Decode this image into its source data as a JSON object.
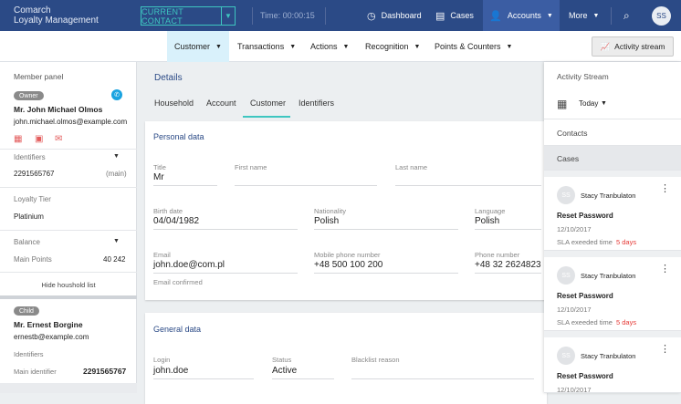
{
  "app": {
    "brand_line1": "Comarch",
    "brand_line2": "Loyalty Management"
  },
  "topbar": {
    "current_contact": "CURRENT CONTACT",
    "timer": "Time: 00:00:15",
    "dashboard": "Dashboard",
    "cases": "Cases",
    "accounts": "Accounts",
    "more": "More",
    "user_initials": "SS"
  },
  "menu": {
    "customer": "Customer",
    "transactions": "Transactions",
    "actions": "Actions",
    "recognition": "Recognition",
    "points_counters": "Points & Counters",
    "activity_stream_btn": "Activity stream"
  },
  "member_panel": {
    "title": "Member panel",
    "owner_badge": "Owner",
    "owner_name": "Mr. John Michael Olmos",
    "owner_email": "john.michael.olmos@example.com",
    "identifiers_label": "Identifiers",
    "identifier_value": "2291565767",
    "identifier_tag": "(main)",
    "tier_label": "Loyalty Tier",
    "tier_value": "Platinium",
    "balance_label": "Balance",
    "main_points_label": "Main Points",
    "main_points_value": "40 242",
    "hide_household": "Hide houshold list",
    "child_badge": "Child",
    "child_name": "Mr. Ernest Borgine",
    "child_email": "ernestb@example.com",
    "child_identifiers_label": "Identifiers",
    "child_main_identifier_label": "Main identifier",
    "child_main_identifier_value": "2291565767"
  },
  "details": {
    "title": "Details",
    "tabs": [
      "Household",
      "Account",
      "Customer",
      "Identifiers"
    ],
    "personal_title": "Personal data",
    "title_label": "Title",
    "title_value": "Mr",
    "first_name_label": "First name",
    "last_name_label": "Last name",
    "birth_label": "Birth date",
    "birth_value": "04/04/1982",
    "nationality_label": "Nationality",
    "nationality_value": "Polish",
    "language_label": "Language",
    "language_value": "Polish",
    "email_label": "Email",
    "email_value": "john.doe@com.pl",
    "mobile_label": "Mobile phone number",
    "mobile_value": "+48 500 100 200",
    "phone_label": "Phone number",
    "phone_value": "+48 32 2624823",
    "email_confirmed": "Email confirmed",
    "general_title": "General data",
    "login_label": "Login",
    "login_value": "john.doe",
    "status_label": "Status",
    "status_value": "Active",
    "blacklist_label": "Blacklist reason"
  },
  "activity": {
    "title": "Activity Stream",
    "period": "Today",
    "contacts": "Contacts",
    "cases": "Cases",
    "items": [
      {
        "initials": "SS",
        "name": "Stacy Tranbulaton",
        "subject": "Reset Password",
        "date": "12/10/2017",
        "sla_label": "SLA exeeded time",
        "sla_value": "5 days"
      },
      {
        "initials": "SS",
        "name": "Stacy Tranbulaton",
        "subject": "Reset Password",
        "date": "12/10/2017",
        "sla_label": "SLA exeeded time",
        "sla_value": "5 days"
      },
      {
        "initials": "SS",
        "name": "Stacy Tranbulaton",
        "subject": "Reset Password",
        "date": "12/10/2017"
      }
    ]
  },
  "colors": {
    "topbar": "#2b4a86",
    "accent": "#3ec6c0",
    "sla_red": "#e53935"
  }
}
